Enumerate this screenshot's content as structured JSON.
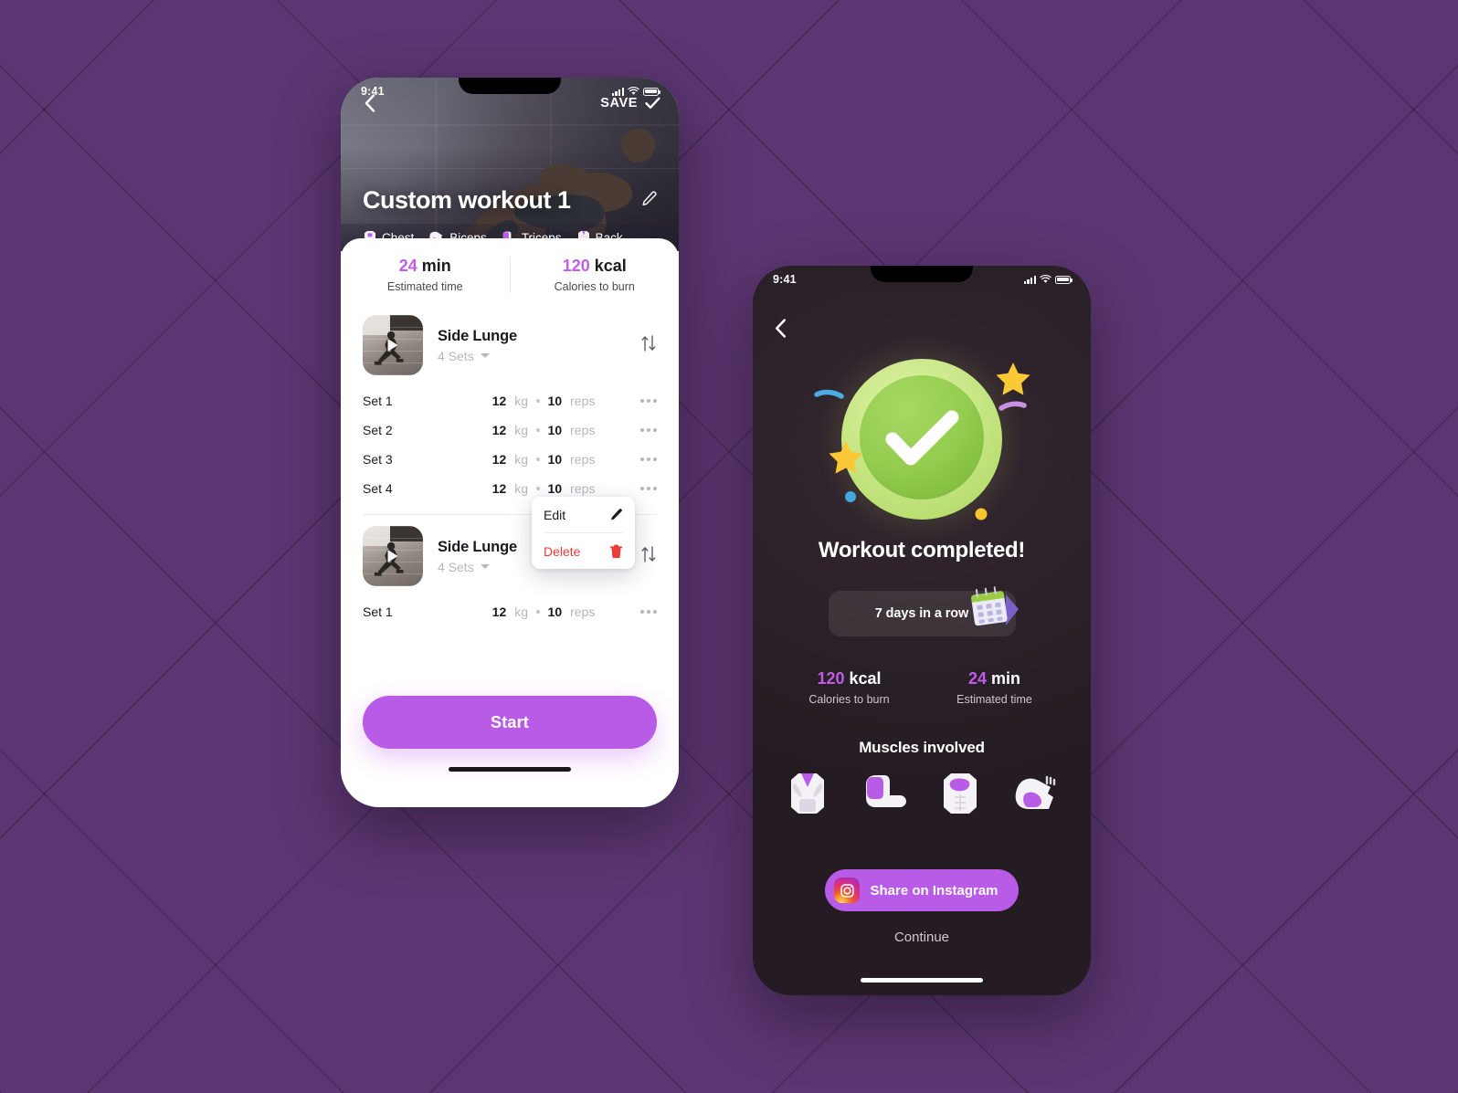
{
  "background": {
    "color": "#5c3672"
  },
  "accent": {
    "purple": "#b85ce8",
    "value_purple": "#c05ce8",
    "danger": "#ec3b3b",
    "green": "#9ed35a"
  },
  "phone_left": {
    "status_bar": {
      "time": "9:41",
      "signal_icon": "cellular-bars-icon",
      "wifi_icon": "wifi-icon",
      "battery_icon": "battery-icon"
    },
    "header": {
      "back_icon": "back-chevron-icon",
      "save_label": "SAVE",
      "save_check_icon": "check-icon",
      "title": "Custom workout 1",
      "edit_icon": "pencil-icon"
    },
    "muscle_tabs": [
      {
        "label": "Chest",
        "icon": "chest-muscle-icon"
      },
      {
        "label": "Biceps",
        "icon": "biceps-muscle-icon"
      },
      {
        "label": "Triceps",
        "icon": "triceps-muscle-icon"
      },
      {
        "label": "Back",
        "icon": "back-muscle-icon"
      }
    ],
    "stats": [
      {
        "value": "24",
        "unit": "min",
        "label": "Estimated time"
      },
      {
        "value": "120",
        "unit": "kcal",
        "label": "Calories to burn"
      }
    ],
    "exercises": [
      {
        "name": "Side Lunge",
        "sets_label": "4 Sets",
        "thumb_icon": "exercise-video-thumbnail",
        "play_icon": "play-icon",
        "reorder_icon": "reorder-arrows-icon",
        "sets": [
          {
            "name": "Set 1",
            "weight": "12",
            "weight_unit": "kg",
            "reps": "10",
            "reps_unit": "reps",
            "more_icon": "more-dots-icon"
          },
          {
            "name": "Set 2",
            "weight": "12",
            "weight_unit": "kg",
            "reps": "10",
            "reps_unit": "reps",
            "more_icon": "more-dots-icon"
          },
          {
            "name": "Set 3",
            "weight": "12",
            "weight_unit": "kg",
            "reps": "10",
            "reps_unit": "reps",
            "more_icon": "more-dots-icon"
          },
          {
            "name": "Set 4",
            "weight": "12",
            "weight_unit": "kg",
            "reps": "10",
            "reps_unit": "reps",
            "more_icon": "more-dots-icon"
          }
        ]
      },
      {
        "name": "Side Lunge",
        "sets_label": "4 Sets",
        "thumb_icon": "exercise-video-thumbnail",
        "play_icon": "play-icon",
        "reorder_icon": "reorder-arrows-icon",
        "sets": [
          {
            "name": "Set 1",
            "weight": "12",
            "weight_unit": "kg",
            "reps": "10",
            "reps_unit": "reps",
            "more_icon": "more-dots-icon"
          }
        ]
      }
    ],
    "context_menu": {
      "edit_label": "Edit",
      "edit_icon": "pencil-icon",
      "delete_label": "Delete",
      "delete_icon": "trash-icon"
    },
    "start_label": "Start"
  },
  "phone_right": {
    "status_bar": {
      "time": "9:41",
      "signal_icon": "cellular-bars-icon",
      "wifi_icon": "wifi-icon",
      "battery_icon": "battery-icon"
    },
    "back_icon": "back-chevron-icon",
    "success_icon": "green-check-badge-icon",
    "title": "Workout completed!",
    "streak": {
      "label": "7 days in a row",
      "icon": "calendar-icon"
    },
    "stats": [
      {
        "value": "120",
        "unit": "kcal",
        "label": "Calories to burn"
      },
      {
        "value": "24",
        "unit": "min",
        "label": "Estimated time"
      }
    ],
    "muscles_title": "Muscles involved",
    "muscle_icons": [
      {
        "name": "back-muscle-icon"
      },
      {
        "name": "triceps-muscle-icon"
      },
      {
        "name": "chest-muscle-icon"
      },
      {
        "name": "biceps-muscle-icon"
      }
    ],
    "share_label": "Share on Instagram",
    "share_icon": "instagram-icon",
    "continue_label": "Continue"
  }
}
